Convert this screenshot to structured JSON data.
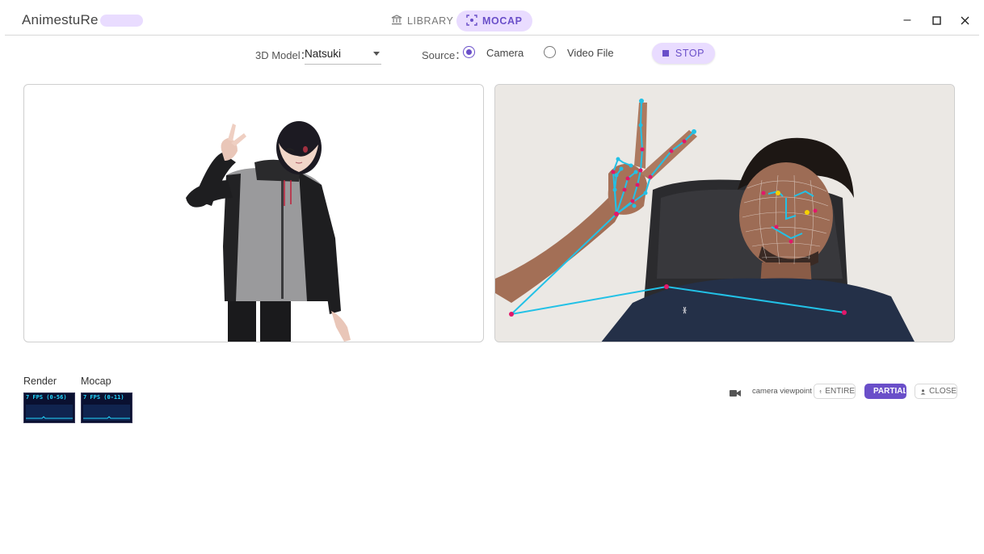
{
  "app": {
    "title": "AnimestuRe"
  },
  "nav": {
    "tabs": [
      {
        "label": "LIBRARY",
        "icon": "library-icon"
      },
      {
        "label": "MOCAP",
        "icon": "mocap-icon"
      }
    ],
    "active_tab": "MOCAP"
  },
  "window_controls": {
    "minimize": "–",
    "maximize": "☐",
    "close": "✕"
  },
  "controls": {
    "model_label": "3D Model：",
    "model_value": "Natsuki",
    "source_label": "Source：",
    "source_options": [
      "Camera",
      "Video File"
    ],
    "source_selected": "Camera",
    "stop_label": "STOP"
  },
  "stats": {
    "render": {
      "label": "Render",
      "text": "7 FPS (0-56)"
    },
    "mocap": {
      "label": "Mocap",
      "text": "7 FPS (0-11)"
    }
  },
  "toolbar": {
    "camera_icon": "video-camera-icon",
    "camera_text": "camera viewpoint",
    "modes": [
      {
        "label": "ENTIRE",
        "icon": "full-body-icon"
      },
      {
        "label": "PARTIAL",
        "icon": "half-body-icon"
      },
      {
        "label": "CLOSE",
        "icon": "person-icon"
      }
    ],
    "active_mode": "PARTIAL"
  },
  "colors": {
    "accent": "#6a4fc9",
    "accent_light": "#e9dcff",
    "landmark_line": "#22c1e6",
    "landmark_point": "#e2176a",
    "stats_bg": "#0a1030",
    "stats_text": "#22d7ff"
  }
}
